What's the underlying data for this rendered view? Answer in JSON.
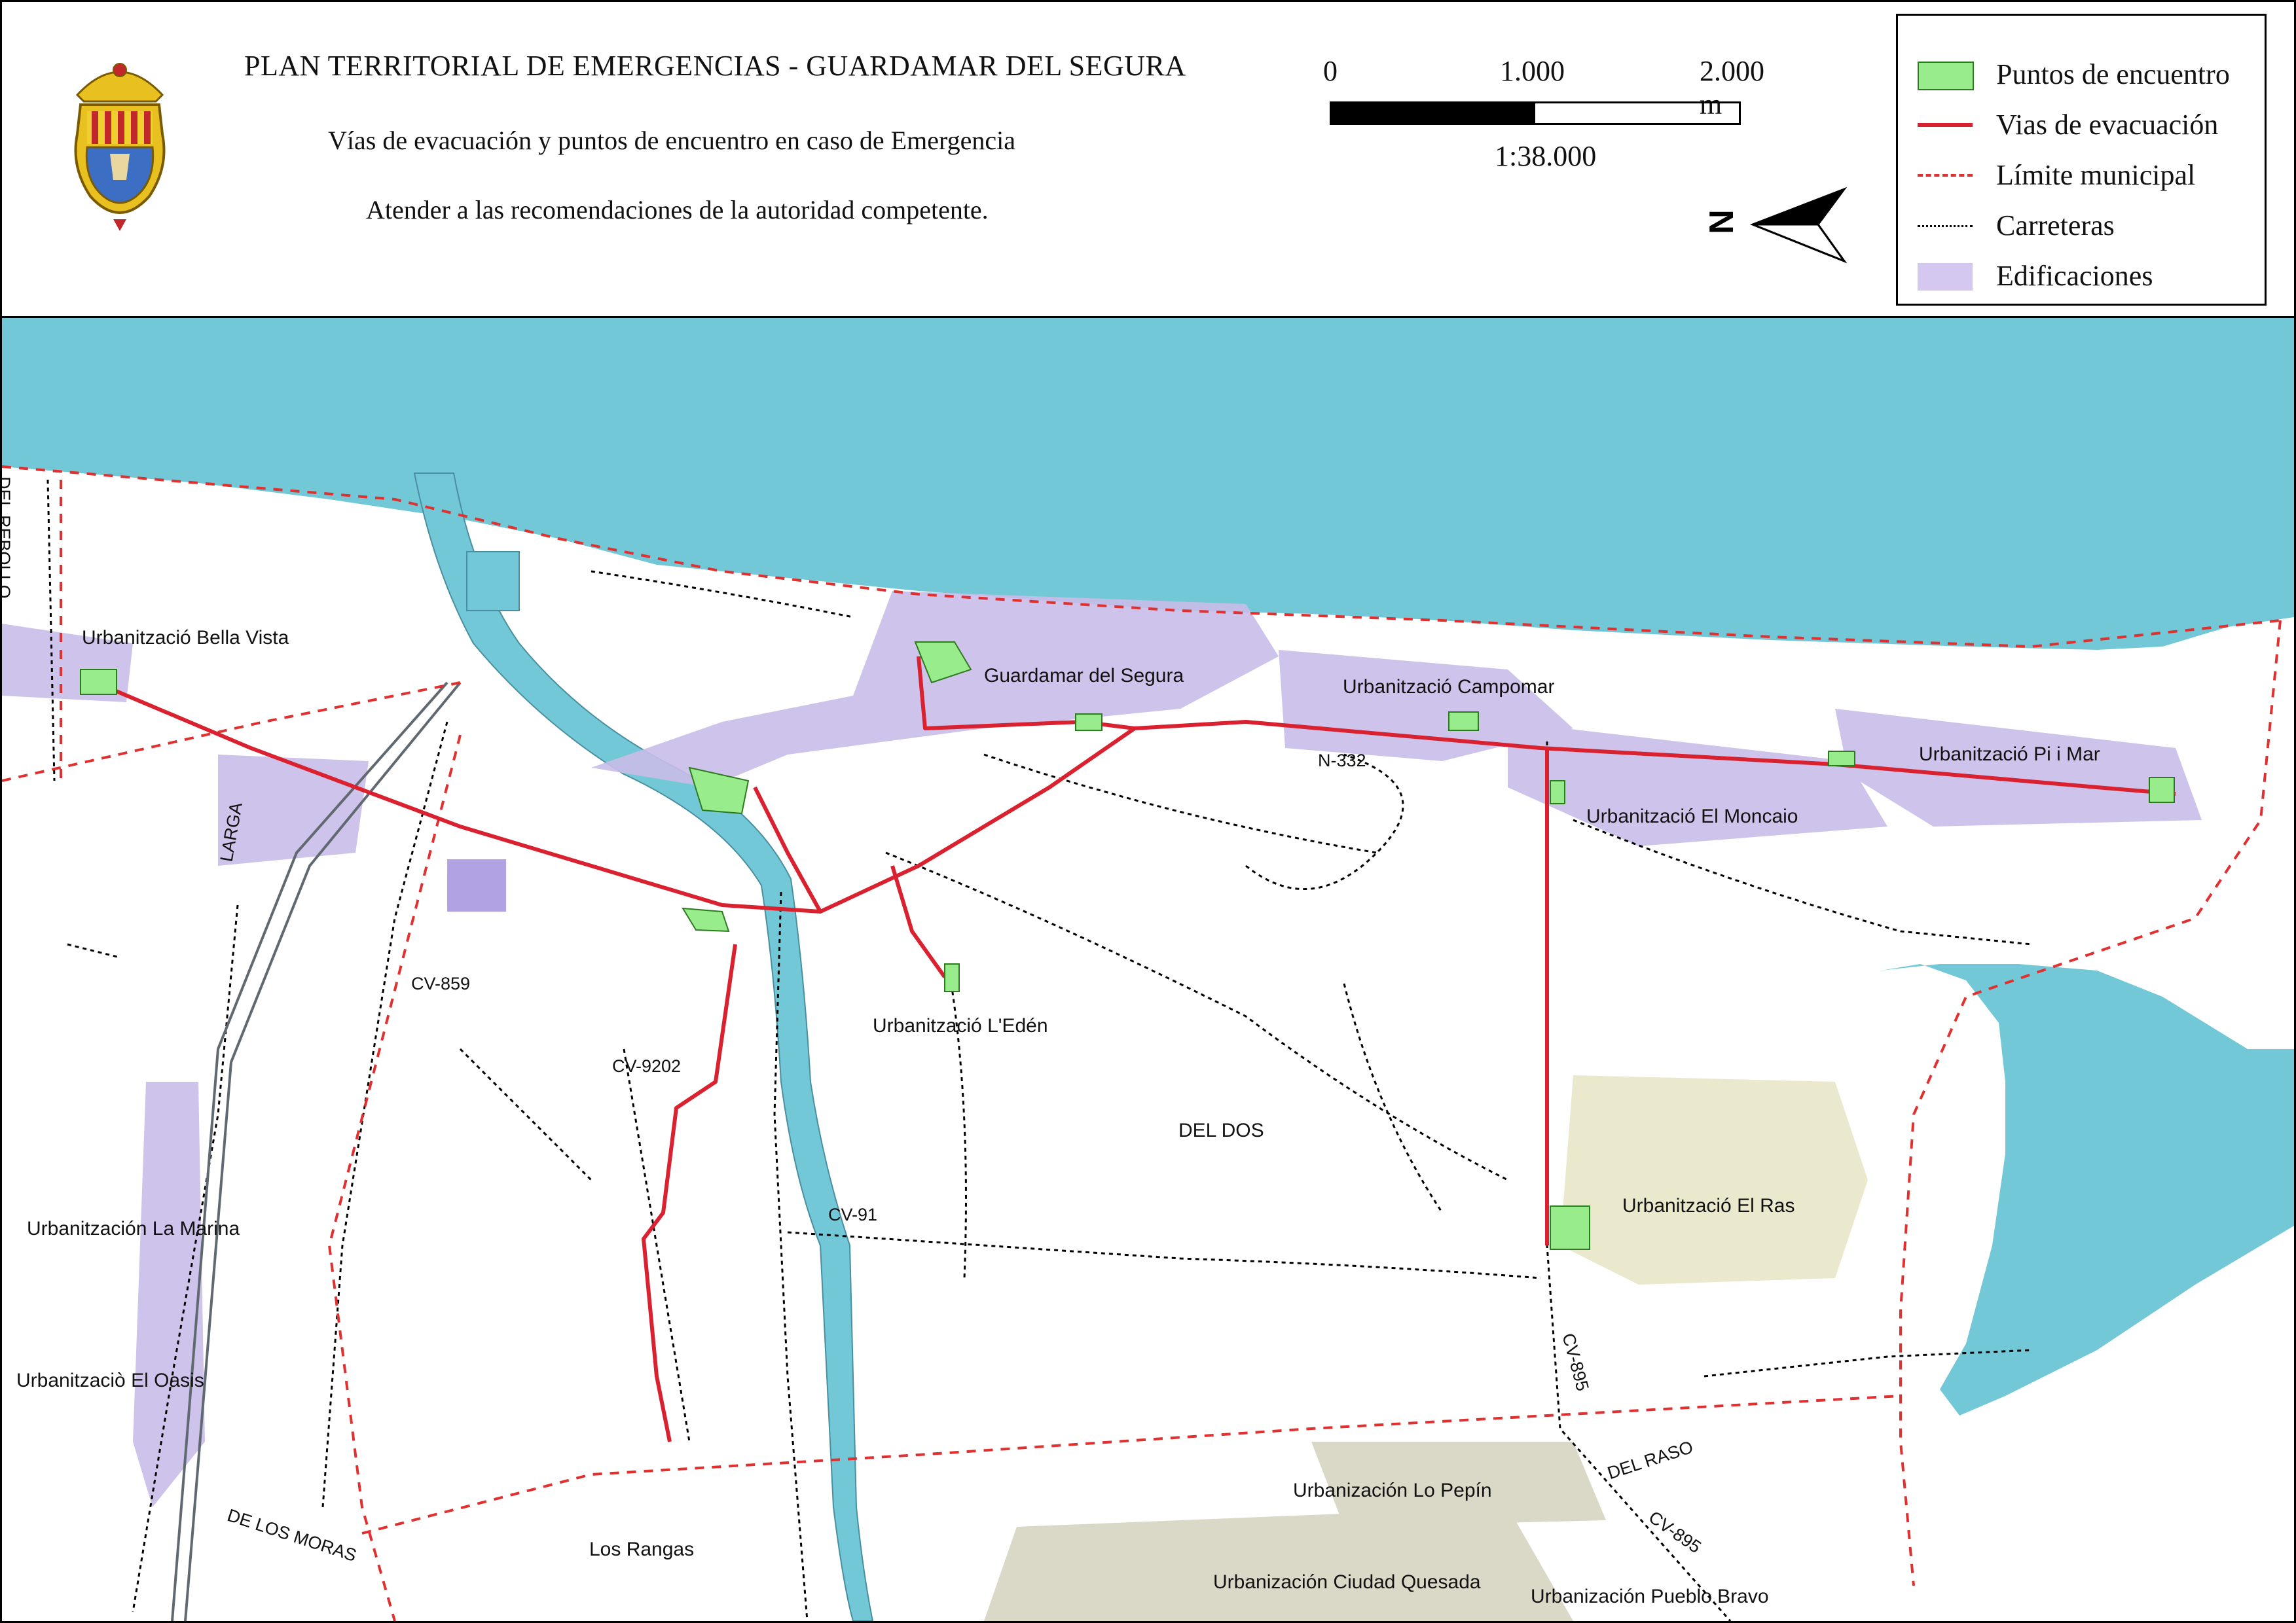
{
  "header": {
    "title": "PLAN TERRITORIAL DE EMERGENCIAS - GUARDAMAR DEL SEGURA",
    "subtitle": "Vías de evacuación y  puntos de encuentro en caso de Emergencia",
    "note": "Atender a las recomendaciones de la autoridad competente."
  },
  "scale": {
    "tick_0": "0",
    "tick_mid": "1.000",
    "tick_end": "2.000 m",
    "ratio": "1:38.000"
  },
  "north_arrow": {
    "label": "N",
    "icon": "north-arrow-icon"
  },
  "legend": {
    "items": [
      {
        "label": "Puntos de encuentro",
        "symbol": "green-fill-box",
        "color": "#98ec8c"
      },
      {
        "label": "Vias de evacuación",
        "symbol": "red-solid-line",
        "color": "#d9212f"
      },
      {
        "label": "Límite municipal",
        "symbol": "red-dashed-line",
        "color": "#e03030"
      },
      {
        "label": "Carreteras",
        "symbol": "black-dotted-line",
        "color": "#000000"
      },
      {
        "label": "Edificaciones",
        "symbol": "lavender-fill-box",
        "color": "#d4c8f0"
      }
    ]
  },
  "colors": {
    "sea": "#72c8d6",
    "river": "#72c8d6",
    "evacuation": "#d9212f",
    "boundary": "#e03030",
    "meeting_point": "#98ec8c",
    "buildings": "#c9bde9"
  },
  "map": {
    "places": [
      "Urbanització Bella Vista",
      "Guardamar del Segura",
      "Urbanització Campomar",
      "Urbanització Pi i Mar",
      "Urbanització El Moncaio",
      "Urbanització L'Edén",
      "DEL DOS",
      "Urbanització El Ras",
      "Urbanitzación La Marina",
      "Urbanitzaciò  El Oasis",
      "Urbanización Lo Pepín",
      "Los Rangas",
      "Urbanización Ciudad Quesada",
      "Urbanización Pueblo Bravo"
    ],
    "roads": [
      "DEL REBOLLO",
      "LARGA",
      "CV-859",
      "CV-9202",
      "CV-91",
      "N-332",
      "CV-895",
      "DEL RASO",
      "CV-895",
      "DE LOS MORAS"
    ]
  }
}
